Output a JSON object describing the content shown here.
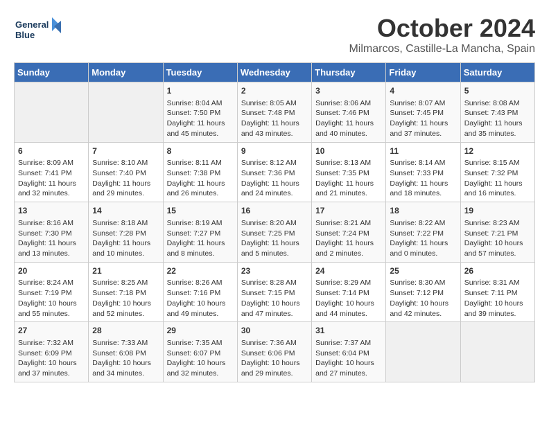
{
  "header": {
    "logo_line1": "General",
    "logo_line2": "Blue",
    "month_title": "October 2024",
    "location": "Milmarcos, Castille-La Mancha, Spain"
  },
  "days_of_week": [
    "Sunday",
    "Monday",
    "Tuesday",
    "Wednesday",
    "Thursday",
    "Friday",
    "Saturday"
  ],
  "weeks": [
    [
      {
        "day": "",
        "lines": []
      },
      {
        "day": "",
        "lines": []
      },
      {
        "day": "1",
        "lines": [
          "Sunrise: 8:04 AM",
          "Sunset: 7:50 PM",
          "Daylight: 11 hours",
          "and 45 minutes."
        ]
      },
      {
        "day": "2",
        "lines": [
          "Sunrise: 8:05 AM",
          "Sunset: 7:48 PM",
          "Daylight: 11 hours",
          "and 43 minutes."
        ]
      },
      {
        "day": "3",
        "lines": [
          "Sunrise: 8:06 AM",
          "Sunset: 7:46 PM",
          "Daylight: 11 hours",
          "and 40 minutes."
        ]
      },
      {
        "day": "4",
        "lines": [
          "Sunrise: 8:07 AM",
          "Sunset: 7:45 PM",
          "Daylight: 11 hours",
          "and 37 minutes."
        ]
      },
      {
        "day": "5",
        "lines": [
          "Sunrise: 8:08 AM",
          "Sunset: 7:43 PM",
          "Daylight: 11 hours",
          "and 35 minutes."
        ]
      }
    ],
    [
      {
        "day": "6",
        "lines": [
          "Sunrise: 8:09 AM",
          "Sunset: 7:41 PM",
          "Daylight: 11 hours",
          "and 32 minutes."
        ]
      },
      {
        "day": "7",
        "lines": [
          "Sunrise: 8:10 AM",
          "Sunset: 7:40 PM",
          "Daylight: 11 hours",
          "and 29 minutes."
        ]
      },
      {
        "day": "8",
        "lines": [
          "Sunrise: 8:11 AM",
          "Sunset: 7:38 PM",
          "Daylight: 11 hours",
          "and 26 minutes."
        ]
      },
      {
        "day": "9",
        "lines": [
          "Sunrise: 8:12 AM",
          "Sunset: 7:36 PM",
          "Daylight: 11 hours",
          "and 24 minutes."
        ]
      },
      {
        "day": "10",
        "lines": [
          "Sunrise: 8:13 AM",
          "Sunset: 7:35 PM",
          "Daylight: 11 hours",
          "and 21 minutes."
        ]
      },
      {
        "day": "11",
        "lines": [
          "Sunrise: 8:14 AM",
          "Sunset: 7:33 PM",
          "Daylight: 11 hours",
          "and 18 minutes."
        ]
      },
      {
        "day": "12",
        "lines": [
          "Sunrise: 8:15 AM",
          "Sunset: 7:32 PM",
          "Daylight: 11 hours",
          "and 16 minutes."
        ]
      }
    ],
    [
      {
        "day": "13",
        "lines": [
          "Sunrise: 8:16 AM",
          "Sunset: 7:30 PM",
          "Daylight: 11 hours",
          "and 13 minutes."
        ]
      },
      {
        "day": "14",
        "lines": [
          "Sunrise: 8:18 AM",
          "Sunset: 7:28 PM",
          "Daylight: 11 hours",
          "and 10 minutes."
        ]
      },
      {
        "day": "15",
        "lines": [
          "Sunrise: 8:19 AM",
          "Sunset: 7:27 PM",
          "Daylight: 11 hours",
          "and 8 minutes."
        ]
      },
      {
        "day": "16",
        "lines": [
          "Sunrise: 8:20 AM",
          "Sunset: 7:25 PM",
          "Daylight: 11 hours",
          "and 5 minutes."
        ]
      },
      {
        "day": "17",
        "lines": [
          "Sunrise: 8:21 AM",
          "Sunset: 7:24 PM",
          "Daylight: 11 hours",
          "and 2 minutes."
        ]
      },
      {
        "day": "18",
        "lines": [
          "Sunrise: 8:22 AM",
          "Sunset: 7:22 PM",
          "Daylight: 11 hours",
          "and 0 minutes."
        ]
      },
      {
        "day": "19",
        "lines": [
          "Sunrise: 8:23 AM",
          "Sunset: 7:21 PM",
          "Daylight: 10 hours",
          "and 57 minutes."
        ]
      }
    ],
    [
      {
        "day": "20",
        "lines": [
          "Sunrise: 8:24 AM",
          "Sunset: 7:19 PM",
          "Daylight: 10 hours",
          "and 55 minutes."
        ]
      },
      {
        "day": "21",
        "lines": [
          "Sunrise: 8:25 AM",
          "Sunset: 7:18 PM",
          "Daylight: 10 hours",
          "and 52 minutes."
        ]
      },
      {
        "day": "22",
        "lines": [
          "Sunrise: 8:26 AM",
          "Sunset: 7:16 PM",
          "Daylight: 10 hours",
          "and 49 minutes."
        ]
      },
      {
        "day": "23",
        "lines": [
          "Sunrise: 8:28 AM",
          "Sunset: 7:15 PM",
          "Daylight: 10 hours",
          "and 47 minutes."
        ]
      },
      {
        "day": "24",
        "lines": [
          "Sunrise: 8:29 AM",
          "Sunset: 7:14 PM",
          "Daylight: 10 hours",
          "and 44 minutes."
        ]
      },
      {
        "day": "25",
        "lines": [
          "Sunrise: 8:30 AM",
          "Sunset: 7:12 PM",
          "Daylight: 10 hours",
          "and 42 minutes."
        ]
      },
      {
        "day": "26",
        "lines": [
          "Sunrise: 8:31 AM",
          "Sunset: 7:11 PM",
          "Daylight: 10 hours",
          "and 39 minutes."
        ]
      }
    ],
    [
      {
        "day": "27",
        "lines": [
          "Sunrise: 7:32 AM",
          "Sunset: 6:09 PM",
          "Daylight: 10 hours",
          "and 37 minutes."
        ]
      },
      {
        "day": "28",
        "lines": [
          "Sunrise: 7:33 AM",
          "Sunset: 6:08 PM",
          "Daylight: 10 hours",
          "and 34 minutes."
        ]
      },
      {
        "day": "29",
        "lines": [
          "Sunrise: 7:35 AM",
          "Sunset: 6:07 PM",
          "Daylight: 10 hours",
          "and 32 minutes."
        ]
      },
      {
        "day": "30",
        "lines": [
          "Sunrise: 7:36 AM",
          "Sunset: 6:06 PM",
          "Daylight: 10 hours",
          "and 29 minutes."
        ]
      },
      {
        "day": "31",
        "lines": [
          "Sunrise: 7:37 AM",
          "Sunset: 6:04 PM",
          "Daylight: 10 hours",
          "and 27 minutes."
        ]
      },
      {
        "day": "",
        "lines": []
      },
      {
        "day": "",
        "lines": []
      }
    ]
  ]
}
